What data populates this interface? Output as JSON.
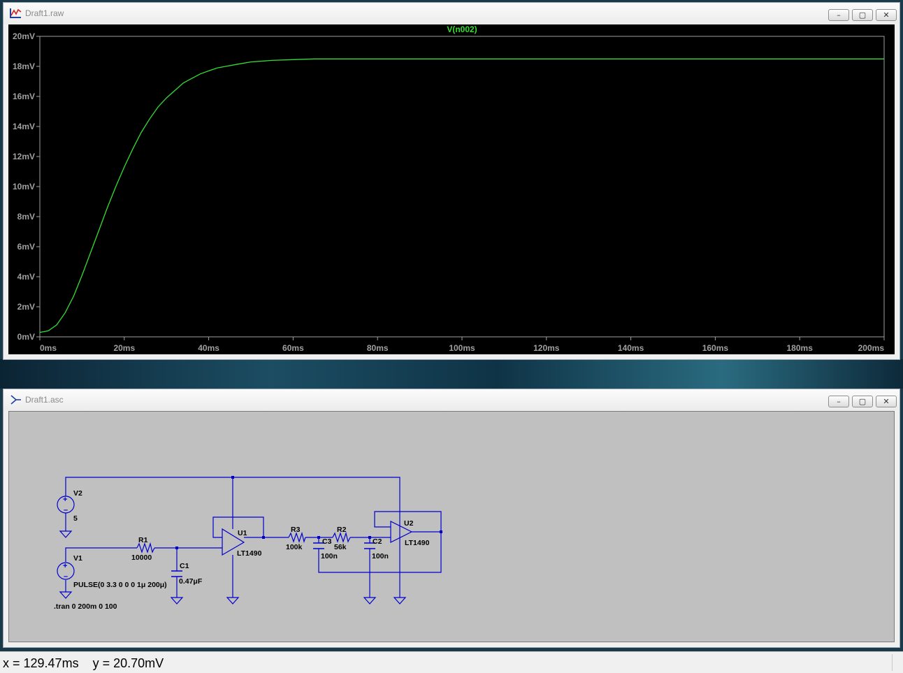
{
  "plot_window": {
    "title": "Draft1.raw",
    "buttons": {
      "minimize": "–",
      "maximize": "▢",
      "close": "✕"
    }
  },
  "schematic_window": {
    "title": "Draft1.asc",
    "buttons": {
      "minimize": "–",
      "maximize": "▢",
      "close": "✕"
    },
    "components": {
      "v2": {
        "name": "V2",
        "value": "5"
      },
      "v1": {
        "name": "V1",
        "value": "PULSE(0 3.3 0 0 0 1μ 200μ)"
      },
      "r1": {
        "name": "R1",
        "value": "10000"
      },
      "c1": {
        "name": "C1",
        "value": "0.47μF"
      },
      "u1": {
        "name": "U1",
        "value": "LT1490"
      },
      "r3": {
        "name": "R3",
        "value": "100k"
      },
      "c3": {
        "name": "C3",
        "value": "100n"
      },
      "r2": {
        "name": "R2",
        "value": "56k"
      },
      "c2": {
        "name": "C2",
        "value": "100n"
      },
      "u2": {
        "name": "U2",
        "value": "LT1490"
      },
      "directive": ".tran 0 200m 0 100"
    }
  },
  "status_bar": {
    "cursor_readout": "x = 129.47ms    y = 20.70mV"
  },
  "colors": {
    "plot_background": "#000000",
    "trace": "#33dd33",
    "axis": "#a0a0a0",
    "wire": "#0000cc",
    "schematic_background": "#c0c0c0"
  },
  "chart_data": {
    "type": "line",
    "title": "V(n002)",
    "xlabel": "",
    "ylabel": "",
    "xlim": [
      0,
      200
    ],
    "ylim": [
      0,
      20
    ],
    "x_tick_labels": [
      "0ms",
      "20ms",
      "40ms",
      "60ms",
      "80ms",
      "100ms",
      "120ms",
      "140ms",
      "160ms",
      "180ms",
      "200ms"
    ],
    "y_tick_labels": [
      "0mV",
      "2mV",
      "4mV",
      "6mV",
      "8mV",
      "10mV",
      "12mV",
      "14mV",
      "16mV",
      "18mV",
      "20mV"
    ],
    "grid": false,
    "series": [
      {
        "name": "V(n002)",
        "x": [
          0,
          2,
          4,
          6,
          8,
          10,
          12,
          14,
          16,
          18,
          20,
          22,
          24,
          26,
          28,
          30,
          32,
          34,
          36,
          38,
          40,
          42,
          44,
          46,
          48,
          50,
          55,
          60,
          65,
          70,
          80,
          90,
          100,
          120,
          140,
          160,
          180,
          200
        ],
        "y": [
          0.3,
          0.4,
          0.8,
          1.6,
          2.7,
          4.1,
          5.6,
          7.1,
          8.6,
          10.0,
          11.3,
          12.5,
          13.6,
          14.5,
          15.3,
          15.9,
          16.4,
          16.9,
          17.2,
          17.5,
          17.7,
          17.9,
          18.0,
          18.1,
          18.2,
          18.3,
          18.4,
          18.45,
          18.5,
          18.5,
          18.5,
          18.5,
          18.5,
          18.5,
          18.5,
          18.5,
          18.5,
          18.5
        ]
      }
    ]
  }
}
